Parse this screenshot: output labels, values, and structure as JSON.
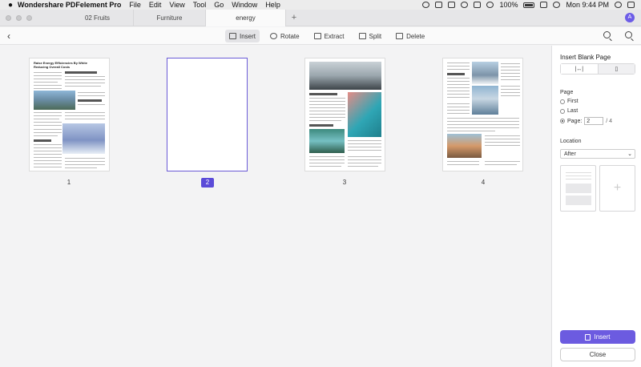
{
  "menubar": {
    "app_name": "Wondershare PDFelement Pro",
    "menus": [
      "File",
      "Edit",
      "View",
      "Tool",
      "Go",
      "Window",
      "Help"
    ],
    "battery": "100%",
    "clock": "Mon 9:44 PM"
  },
  "tabs": [
    {
      "label": "02 Fruits"
    },
    {
      "label": "Furniture"
    },
    {
      "label": "energy"
    }
  ],
  "user_initial": "A",
  "toolbar": {
    "insert_label": "Insert",
    "rotate_label": "Rotate",
    "extract_label": "Extract",
    "split_label": "Split",
    "delete_label": "Delete"
  },
  "pages": [
    {
      "number": "1",
      "title": "Raise Energy Efficiencies By White Reducing Overall Costs"
    },
    {
      "number": "2"
    },
    {
      "number": "3"
    },
    {
      "number": "4"
    }
  ],
  "panel": {
    "title": "Insert Blank Page",
    "page_label": "Page",
    "first_label": "First",
    "last_label": "Last",
    "page_option_label": "Page:",
    "page_value": "2",
    "page_total": "/ 4",
    "location_label": "Location",
    "location_value": "After",
    "insert_button": "Insert",
    "close_button": "Close"
  },
  "colors": {
    "accent": "#6c5be0",
    "selected_border": "#6a5bd6"
  }
}
